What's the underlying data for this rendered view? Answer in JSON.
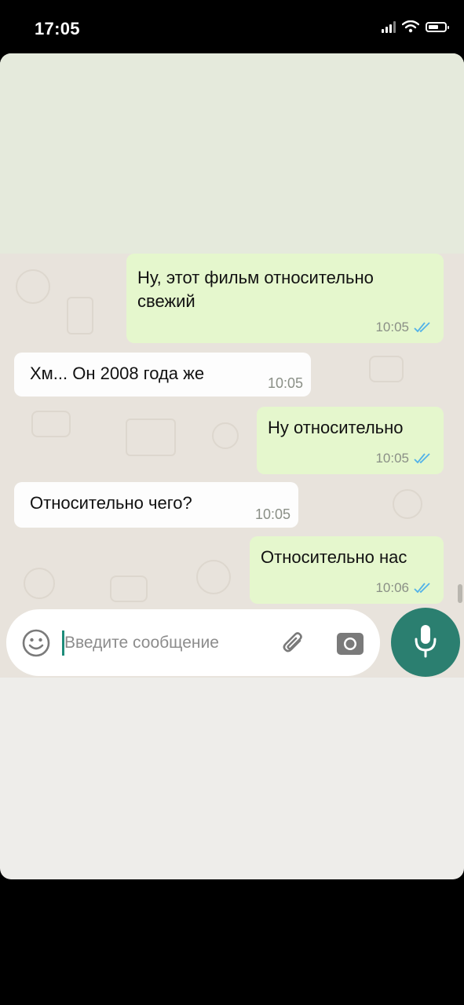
{
  "status_bar": {
    "time": "17:05"
  },
  "messages": [
    {
      "direction": "outgoing",
      "text": "Ну, этот фильм относительно\nсвежий",
      "time": "10:05",
      "read": true
    },
    {
      "direction": "incoming",
      "text": "Хм... Он 2008 года же",
      "time": "10:05"
    },
    {
      "direction": "outgoing",
      "text": "Ну относительно",
      "time": "10:05",
      "read": true
    },
    {
      "direction": "incoming",
      "text": "Относительно чего?",
      "time": "10:05"
    },
    {
      "direction": "outgoing",
      "text": "Относительно нас",
      "time": "10:06",
      "read": true
    }
  ],
  "input": {
    "placeholder": "Введите сообщение"
  },
  "icons": {
    "emoji": "emoji-icon",
    "attach": "paperclip-icon",
    "camera": "camera-icon",
    "mic": "microphone-icon"
  },
  "colors": {
    "outgoing_bubble": "#e5f7cd",
    "incoming_bubble": "#fdfdfd",
    "chat_background": "#e8e3dc",
    "read_ticks": "#53b2e8",
    "mic_button": "#2b7f70"
  }
}
